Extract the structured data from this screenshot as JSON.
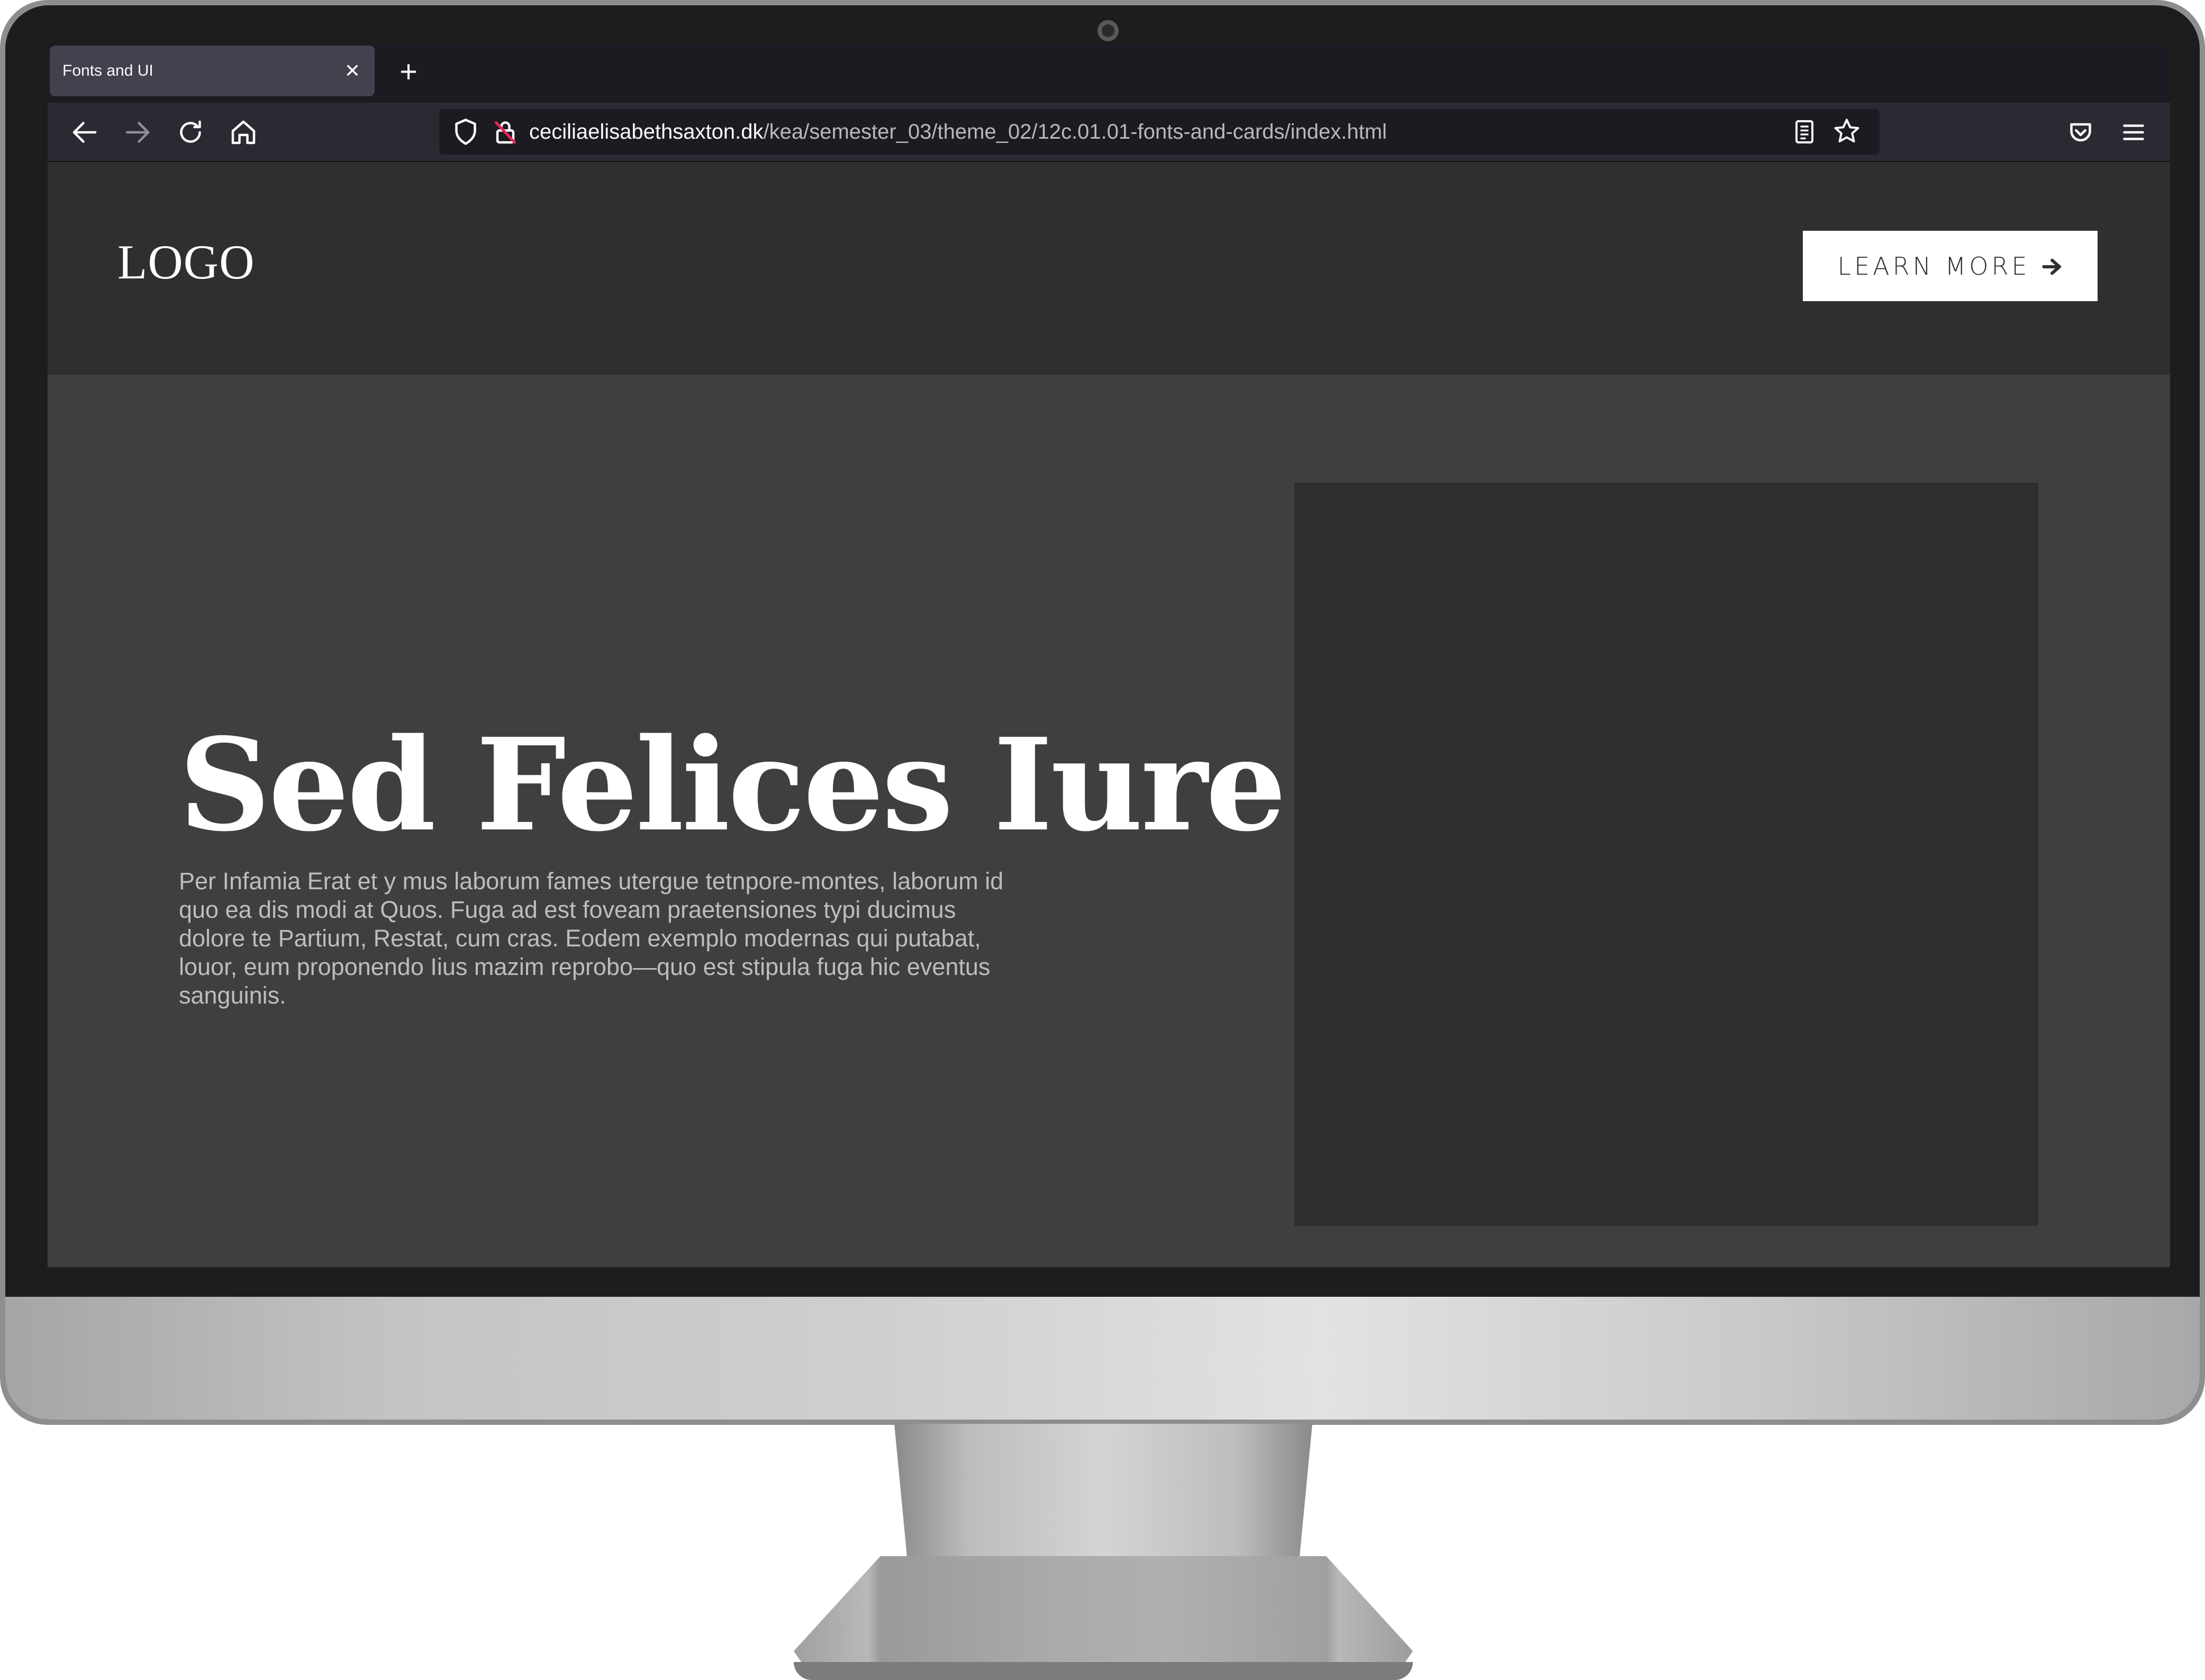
{
  "browser": {
    "tab": {
      "title": "Fonts and UI",
      "close_icon": "close-icon"
    },
    "new_tab_icon": "plus-icon",
    "nav": {
      "back_icon": "arrow-left-icon",
      "forward_icon": "arrow-right-icon",
      "reload_icon": "reload-icon",
      "home_icon": "home-icon"
    },
    "url": {
      "domain": "ceciliaelisabethsaxton.dk",
      "path": "/kea/semester_03/theme_02/12c.01.01-fonts-and-cards/index.html"
    }
  },
  "page": {
    "header": {
      "logo": "LOGO",
      "cta_label": "LEARN MORE"
    },
    "hero": {
      "title": "Sed Felices Iure",
      "body": "Per Infamia Erat et y mus laborum fames utergue tetnpore-montes, laborum id quo ea dis modi at Quos. Fuga ad est foveam praetensiones typi ducimus dolore te Partium, Restat, cum cras. Eodem exemplo modernas qui putabat, louor, eum proponendo Iius mazim reprobo—quo est stipula fuga hic eventus sanguinis."
    }
  },
  "colors": {
    "header_bg": "#2f2f2f",
    "hero_bg": "#3f3f3f",
    "image_placeholder": "#2f2f2f",
    "tab_bar": "#1c1b22",
    "toolbar": "#2b2a33"
  }
}
